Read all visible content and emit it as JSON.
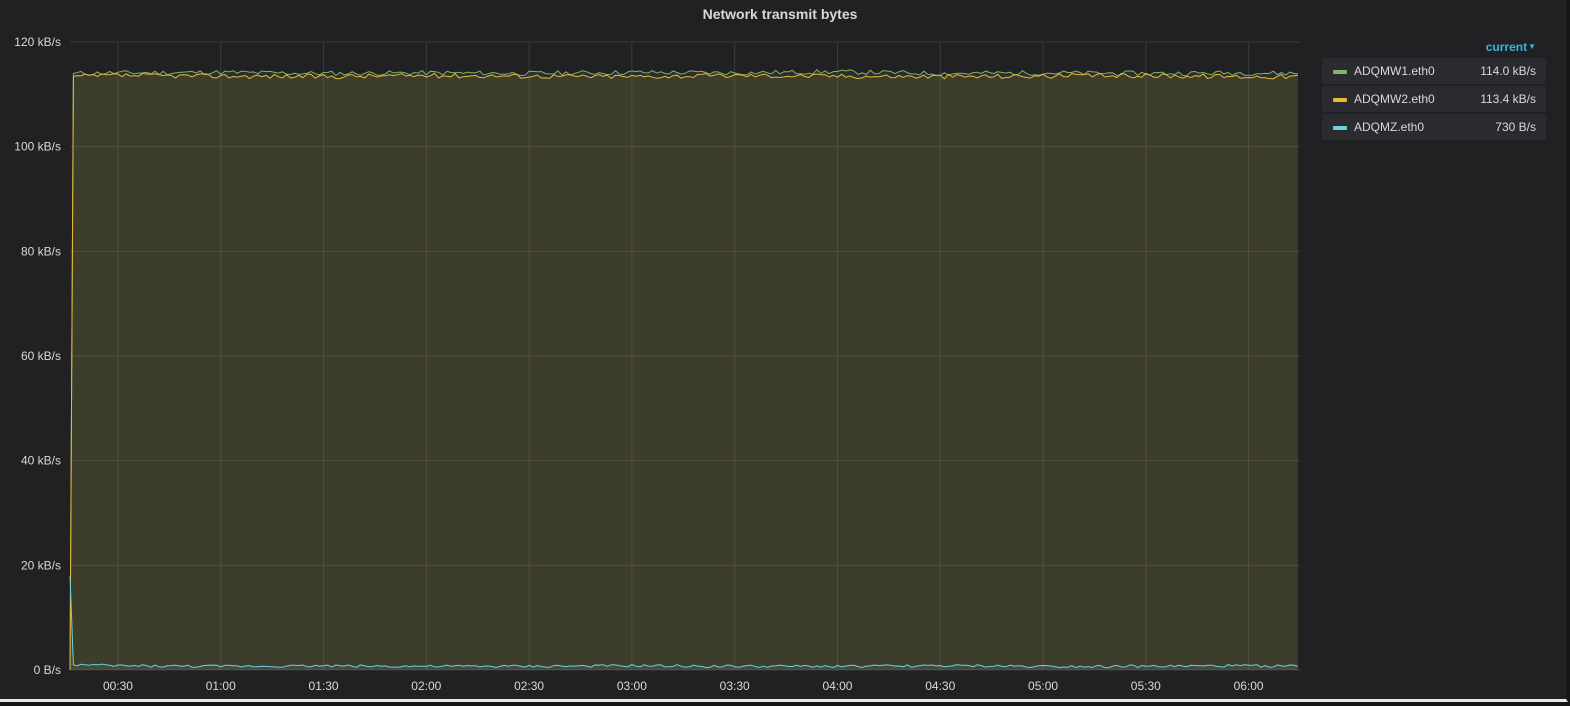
{
  "panel": {
    "title": "Network transmit bytes"
  },
  "legend": {
    "sort_label": "current",
    "items": [
      {
        "name": "ADQMW1.eth0",
        "value": "114.0 kB/s",
        "color": "#7eb26d"
      },
      {
        "name": "ADQMW2.eth0",
        "value": "113.4 kB/s",
        "color": "#eab839"
      },
      {
        "name": "ADQMZ.eth0",
        "value": "730 B/s",
        "color": "#6ed0e0"
      }
    ]
  },
  "chart_data": {
    "type": "area",
    "title": "Network transmit bytes",
    "xlabel": "",
    "ylabel": "",
    "x_ticks": [
      "00:30",
      "01:00",
      "01:30",
      "02:00",
      "02:30",
      "03:00",
      "03:30",
      "04:00",
      "04:30",
      "05:00",
      "05:30",
      "06:00"
    ],
    "y_ticks": [
      "0 B/s",
      "20 kB/s",
      "40 kB/s",
      "60 kB/s",
      "80 kB/s",
      "100 kB/s",
      "120 kB/s"
    ],
    "ylim_kBps": [
      0,
      120
    ],
    "xlim": [
      "00:16",
      "06:15"
    ],
    "grid": true,
    "legend_position": "right",
    "x": [
      "00:16",
      "00:17",
      "00:30",
      "01:00",
      "01:30",
      "02:00",
      "02:30",
      "03:00",
      "03:30",
      "04:00",
      "04:30",
      "05:00",
      "05:30",
      "06:00",
      "06:15"
    ],
    "series": [
      {
        "name": "ADQMW1.eth0",
        "color": "#7eb26d",
        "unit": "kB/s",
        "values": [
          0,
          114.0,
          114.1,
          114.2,
          114.0,
          114.1,
          114.0,
          114.2,
          114.1,
          114.3,
          114.0,
          114.1,
          114.0,
          114.1,
          114.0
        ]
      },
      {
        "name": "ADQMW2.eth0",
        "color": "#eab839",
        "unit": "kB/s",
        "values": [
          0,
          113.4,
          113.6,
          113.5,
          113.4,
          113.6,
          113.5,
          113.4,
          113.6,
          113.5,
          113.4,
          113.5,
          113.6,
          113.4,
          113.4
        ]
      },
      {
        "name": "ADQMZ.eth0",
        "color": "#6ed0e0",
        "unit": "kB/s",
        "values": [
          18,
          1.0,
          0.8,
          0.7,
          0.8,
          0.7,
          0.7,
          0.8,
          0.7,
          0.7,
          0.8,
          0.7,
          0.7,
          0.8,
          0.73
        ]
      }
    ]
  }
}
